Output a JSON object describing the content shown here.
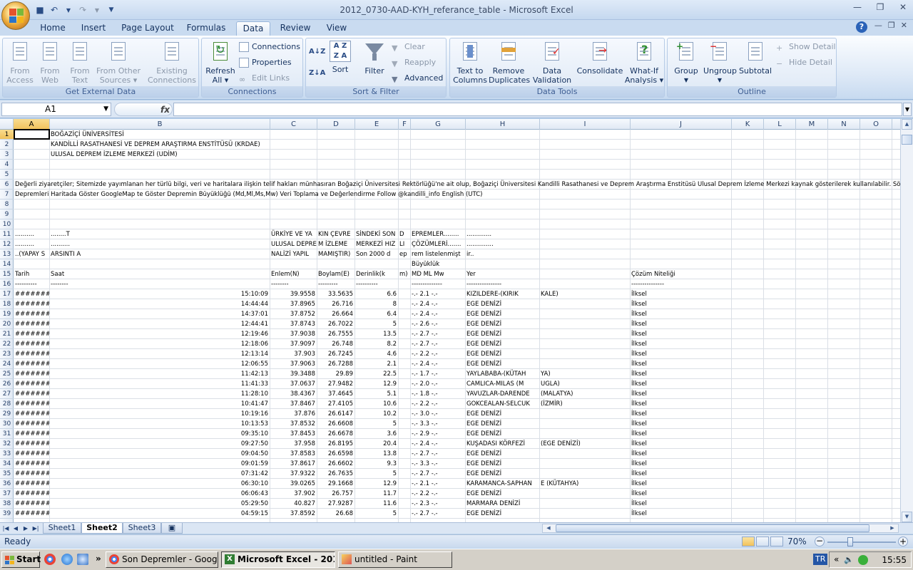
{
  "window": {
    "title": "2012_0730-AAD-KYH_referance_table - Microsoft Excel"
  },
  "ribbon": {
    "tabs": [
      "Home",
      "Insert",
      "Page Layout",
      "Formulas",
      "Data",
      "Review",
      "View"
    ],
    "active_tab": "Data",
    "groups": {
      "get_external": {
        "label": "Get External Data",
        "from_access": [
          "From",
          "Access"
        ],
        "from_web": [
          "From",
          "Web"
        ],
        "from_text": [
          "From",
          "Text"
        ],
        "from_other": [
          "From Other",
          "Sources ▾"
        ],
        "existing": [
          "Existing",
          "Connections"
        ]
      },
      "connections": {
        "label": "Connections",
        "refresh": [
          "Refresh",
          "All ▾"
        ],
        "connections": "Connections",
        "properties": "Properties",
        "edit_links": "Edit Links"
      },
      "sort_filter": {
        "label": "Sort & Filter",
        "sort": "Sort",
        "filter": "Filter",
        "clear": "Clear",
        "reapply": "Reapply",
        "advanced": "Advanced"
      },
      "data_tools": {
        "label": "Data Tools",
        "text_to_columns": [
          "Text to",
          "Columns"
        ],
        "remove_dup": [
          "Remove",
          "Duplicates"
        ],
        "validation": [
          "Data",
          "Validation ▾"
        ],
        "consolidate": "Consolidate",
        "whatif": [
          "What-If",
          "Analysis ▾"
        ]
      },
      "outline": {
        "label": "Outline",
        "group": "Group",
        "ungroup": "Ungroup",
        "subtotal": "Subtotal",
        "show_detail": "Show Detail",
        "hide_detail": "Hide Detail"
      }
    }
  },
  "formula_bar": {
    "name_box": "A1",
    "fx": "fx",
    "formula": ""
  },
  "columns": [
    "A",
    "B",
    "C",
    "D",
    "E",
    "F",
    "G",
    "H",
    "I",
    "J",
    "K",
    "L",
    "M",
    "N",
    "O"
  ],
  "rows": {
    "r1": {
      "b": "BOĞAZİÇİ ÜNİVERSİTESİ"
    },
    "r2": {
      "b": "KANDİLLİ RASATHANESİ VE DEPREM ARAŞTIRMA ENSTİTÜSÜ (KRDAE)"
    },
    "r3": {
      "b": "ULUSAL DEPREM İZLEME MERKEZİ (UDİM)"
    },
    "r6": {
      "a": "Değerli ziyaretçiler; Sitemizde yayımlanan her türlü bilgi, veri ve haritalara ilişkin telif hakları münhasıran Boğaziçi Üniversitesi Rektörlüğü'ne ait olup, Boğaziçi Üniversitesi Kandilli Rasathanesi ve Deprem Araştırma Enstitüsü Ulusal Deprem İzleme Merkezi kaynak gösterilerek kullanılabilir. Söz konusu bilgi, veri ve harita"
    },
    "r7": {
      "a": "Depremleri Haritada Göster     GoogleMap te Göster     Depremin Büyüklüğü (Md,Ml,Ms,Mw)     Veri Toplama ve Değerlendirme     Follow @kandilli_info     English (UTC)"
    },
    "r11": {
      "a": "..........",
      "b": "........T",
      "c": "ÜRKİYE VE YA",
      "d": "KIN ÇEVRE",
      "e": "SİNDEKİ SON",
      "f": "D",
      "g": "EPREMLER........",
      "h": "............."
    },
    "r12": {
      "a": "..........",
      "b": "..........",
      "c": "ULUSAL DEPRE",
      "d": "M İZLEME",
      "e": "MERKEZİ HIZ",
      "f": "LI",
      "g": "ÇÖZÜMLERİ.......",
      "h": ".............."
    },
    "r13": {
      "a": "..(YAPAY S",
      "b": "ARSINTI A",
      "c": "NALİZİ YAPIL",
      "d": "MAMIŞTIR)",
      "e": "Son 2000 d",
      "f": "ep",
      "g": "rem listelenmişt",
      "h": "ir.."
    },
    "r14": {
      "g": "Büyüklük"
    },
    "r15": {
      "a": "Tarih",
      "b": "Saat",
      "c": "Enlem(N)",
      "d": "Boylam(E)",
      "e": "Derinlik(k",
      "f": "m)",
      "g": "MD   ML   Mw",
      "h": "Yer",
      "j": "Çözüm Niteliği"
    },
    "r16": {
      "a": "----------",
      "b": "--------",
      "c": "--------",
      "d": "---------",
      "e": "----------",
      "g": "--------------",
      "h": "----------------",
      "j": "---------------"
    }
  },
  "data_rows": [
    {
      "row": "17",
      "date": "#########",
      "time": "15:10:09",
      "lat": "39.9558",
      "lon": "33.5635",
      "depth": "6.6",
      "mag": "-.-  2.1  -.-",
      "place": "KIZILDERE-(KIRIK",
      "place2": "KALE)",
      "sol": "İlksel"
    },
    {
      "row": "18",
      "date": "#########",
      "time": "14:44:44",
      "lat": "37.8965",
      "lon": "26.716",
      "depth": "8",
      "mag": "-.-  2.4  -.-",
      "place": "EGE DENİZİ",
      "place2": "",
      "sol": "İlksel"
    },
    {
      "row": "19",
      "date": "#########",
      "time": "14:37:01",
      "lat": "37.8752",
      "lon": "26.664",
      "depth": "6.4",
      "mag": "-.-  2.4  -.-",
      "place": "EGE DENİZİ",
      "place2": "",
      "sol": "İlksel"
    },
    {
      "row": "20",
      "date": "#########",
      "time": "12:44:41",
      "lat": "37.8743",
      "lon": "26.7022",
      "depth": "5",
      "mag": "-.-  2.6  -.-",
      "place": "EGE DENİZİ",
      "place2": "",
      "sol": "İlksel"
    },
    {
      "row": "21",
      "date": "#########",
      "time": "12:19:46",
      "lat": "37.9038",
      "lon": "26.7555",
      "depth": "13.5",
      "mag": "-.-  2.7  -.-",
      "place": "EGE DENİZİ",
      "place2": "",
      "sol": "İlksel"
    },
    {
      "row": "22",
      "date": "#########",
      "time": "12:18:06",
      "lat": "37.9097",
      "lon": "26.748",
      "depth": "8.2",
      "mag": "-.-  2.7  -.-",
      "place": "EGE DENİZİ",
      "place2": "",
      "sol": "İlksel"
    },
    {
      "row": "23",
      "date": "#########",
      "time": "12:13:14",
      "lat": "37.903",
      "lon": "26.7245",
      "depth": "4.6",
      "mag": "-.-  2.2  -.-",
      "place": "EGE DENİZİ",
      "place2": "",
      "sol": "İlksel"
    },
    {
      "row": "24",
      "date": "#########",
      "time": "12:06:55",
      "lat": "37.9063",
      "lon": "26.7288",
      "depth": "2.1",
      "mag": "-.-  2.4  -.-",
      "place": "EGE DENİZİ",
      "place2": "",
      "sol": "İlksel"
    },
    {
      "row": "25",
      "date": "#########",
      "time": "11:42:13",
      "lat": "39.3488",
      "lon": "29.89",
      "depth": "22.5",
      "mag": "-.-  1.7  -.-",
      "place": "YAYLABABA-(KÜTAH",
      "place2": "YA)",
      "sol": "İlksel"
    },
    {
      "row": "26",
      "date": "#########",
      "time": "11:41:33",
      "lat": "37.0637",
      "lon": "27.9482",
      "depth": "12.9",
      "mag": "-.-  2.0  -.-",
      "place": "CAMLICA-MILAS (M",
      "place2": "UGLA)",
      "sol": "İlksel"
    },
    {
      "row": "27",
      "date": "#########",
      "time": "11:28:10",
      "lat": "38.4367",
      "lon": "37.4645",
      "depth": "5.1",
      "mag": "-.-  1.8  -.-",
      "place": "YAVUZLAR-DARENDE",
      "place2": "(MALATYA)",
      "sol": "İlksel"
    },
    {
      "row": "28",
      "date": "#########",
      "time": "10:41:47",
      "lat": "37.8467",
      "lon": "27.4105",
      "depth": "10.6",
      "mag": "-.-  2.2  -.-",
      "place": "GOKCEALAN-SELCUK",
      "place2": "(İZMİR)",
      "sol": "İlksel"
    },
    {
      "row": "29",
      "date": "#########",
      "time": "10:19:16",
      "lat": "37.876",
      "lon": "26.6147",
      "depth": "10.2",
      "mag": "-.-  3.0  -.-",
      "place": "EGE DENİZİ",
      "place2": "",
      "sol": "İlksel"
    },
    {
      "row": "30",
      "date": "#########",
      "time": "10:13:53",
      "lat": "37.8532",
      "lon": "26.6608",
      "depth": "5",
      "mag": "-.-  3.3  -.-",
      "place": "EGE DENİZİ",
      "place2": "",
      "sol": "İlksel"
    },
    {
      "row": "31",
      "date": "#########",
      "time": "09:35:10",
      "lat": "37.8453",
      "lon": "26.6678",
      "depth": "3.6",
      "mag": "-.-  2.9  -.-",
      "place": "EGE DENİZİ",
      "place2": "",
      "sol": "İlksel"
    },
    {
      "row": "32",
      "date": "#########",
      "time": "09:27:50",
      "lat": "37.958",
      "lon": "26.8195",
      "depth": "20.4",
      "mag": "-.-  2.4  -.-",
      "place": "KUŞADASI KÖRFEZİ",
      "place2": "(EGE DENİZİ)",
      "sol": "İlksel"
    },
    {
      "row": "33",
      "date": "#########",
      "time": "09:04:50",
      "lat": "37.8583",
      "lon": "26.6598",
      "depth": "13.8",
      "mag": "-.-  2.7  -.-",
      "place": "EGE DENİZİ",
      "place2": "",
      "sol": "İlksel"
    },
    {
      "row": "34",
      "date": "#########",
      "time": "09:01:59",
      "lat": "37.8617",
      "lon": "26.6602",
      "depth": "9.3",
      "mag": "-.-  3.3  -.-",
      "place": "EGE DENİZİ",
      "place2": "",
      "sol": "İlksel"
    },
    {
      "row": "35",
      "date": "#########",
      "time": "07:31:42",
      "lat": "37.9322",
      "lon": "26.7635",
      "depth": "5",
      "mag": "-.-  2.7  -.-",
      "place": "EGE DENİZİ",
      "place2": "",
      "sol": "İlksel"
    },
    {
      "row": "36",
      "date": "#########",
      "time": "06:30:10",
      "lat": "39.0265",
      "lon": "29.1668",
      "depth": "12.9",
      "mag": "-.-  2.1  -.-",
      "place": "KARAMANCA-SAPHAN",
      "place2": "E (KÜTAHYA)",
      "sol": "İlksel"
    },
    {
      "row": "37",
      "date": "#########",
      "time": "06:06:43",
      "lat": "37.902",
      "lon": "26.757",
      "depth": "11.7",
      "mag": "-.-  2.2  -.-",
      "place": "EGE DENİZİ",
      "place2": "",
      "sol": "İlksel"
    },
    {
      "row": "38",
      "date": "#########",
      "time": "05:29:50",
      "lat": "40.827",
      "lon": "27.9287",
      "depth": "11.6",
      "mag": "-.-  2.3  -.-",
      "place": "MARMARA DENİZİ",
      "place2": "",
      "sol": "İlksel"
    },
    {
      "row": "39",
      "date": "#########",
      "time": "04:59:15",
      "lat": "37.8592",
      "lon": "26.68",
      "depth": "5",
      "mag": "-.-  2.7  -.-",
      "place": "EGE DENİZİ",
      "place2": "",
      "sol": "İlksel"
    }
  ],
  "sheet_tabs": [
    "Sheet1",
    "Sheet2",
    "Sheet3"
  ],
  "active_sheet": "Sheet2",
  "status": {
    "text": "Ready",
    "zoom": "70%"
  },
  "taskbar": {
    "start": "Start",
    "tasks": [
      "Son Depremler - Google ...",
      "Microsoft Excel - 201...",
      "untitled - Paint"
    ],
    "lang": "TR",
    "clock": "15:55"
  },
  "colors": {
    "accent": "#2b5797",
    "selection": "#f1c15a",
    "ribbon": "#dfeaf7"
  }
}
